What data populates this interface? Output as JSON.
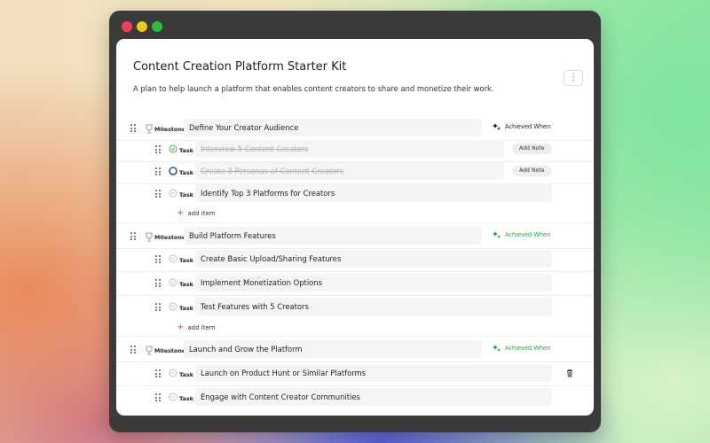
{
  "page": {
    "title": "Content Creation Platform Starter Kit",
    "description": "A plan to help launch a platform that enables content creators to share and monetize their work.",
    "menu_icon": "vertical-dots-icon"
  },
  "labels": {
    "milestone": "Milestone",
    "task": "Task",
    "achieved_when": "Achieved When",
    "add_note": "Add Note",
    "add_item": "add item"
  },
  "milestones": [
    {
      "title": "Define Your Creator Audience",
      "achieved_color": "#222222",
      "tasks": [
        {
          "title": "Interview 5 Content Creators",
          "status": "done"
        },
        {
          "title": "Create 3 Personas of Content Creators",
          "status": "in-progress"
        },
        {
          "title": "Identify Top 3 Platforms for Creators",
          "status": "pending"
        }
      ]
    },
    {
      "title": "Build Platform Features",
      "achieved_color": "#2c9c4a",
      "tasks": [
        {
          "title": "Create Basic Upload/Sharing Features",
          "status": "pending"
        },
        {
          "title": "Implement Monetization Options",
          "status": "pending"
        },
        {
          "title": "Test Features with 5 Creators",
          "status": "pending"
        }
      ]
    },
    {
      "title": "Launch and Grow the Platform",
      "achieved_color": "#2c9c4a",
      "tasks": [
        {
          "title": "Launch on Product Hunt or Similar Platforms",
          "status": "pending"
        },
        {
          "title": "Engage with Content Creator Communities",
          "status": "pending"
        }
      ]
    }
  ],
  "colors": {
    "done": "#3cb35a",
    "in_progress": "#1f5f8b",
    "pending": "#bdbdbd",
    "add_plus": "#e43b5b",
    "window_chrome": "#3b3b3c"
  }
}
